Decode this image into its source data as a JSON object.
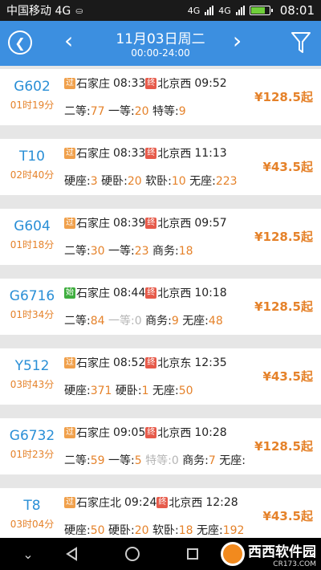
{
  "status": {
    "carrier": "中国移动 4G",
    "net1": "4G",
    "net2": "4G",
    "time": "08:01"
  },
  "header": {
    "date": "11月03日周二",
    "range": "00:00-24:00"
  },
  "trains": [
    {
      "number": "G602",
      "duration": "01时19分",
      "start_badge": "过",
      "from": "石家庄",
      "dep": "08:33",
      "end_badge": "终",
      "to": "北京西",
      "arr": "09:52",
      "price": "¥128.5起",
      "seats": [
        {
          "name": "二等",
          "count": "77"
        },
        {
          "name": "一等",
          "count": "20"
        },
        {
          "name": "特等",
          "count": "9"
        }
      ]
    },
    {
      "number": "T10",
      "duration": "02时40分",
      "start_badge": "过",
      "from": "石家庄",
      "dep": "08:33",
      "end_badge": "终",
      "to": "北京西",
      "arr": "11:13",
      "price": "¥43.5起",
      "seats": [
        {
          "name": "硬座",
          "count": "3"
        },
        {
          "name": "硬卧",
          "count": "20"
        },
        {
          "name": "软卧",
          "count": "10"
        },
        {
          "name": "无座",
          "count": "223"
        }
      ]
    },
    {
      "number": "G604",
      "duration": "01时18分",
      "start_badge": "过",
      "from": "石家庄",
      "dep": "08:39",
      "end_badge": "终",
      "to": "北京西",
      "arr": "09:57",
      "price": "¥128.5起",
      "seats": [
        {
          "name": "二等",
          "count": "30"
        },
        {
          "name": "一等",
          "count": "23"
        },
        {
          "name": "商务",
          "count": "18"
        }
      ]
    },
    {
      "number": "G6716",
      "duration": "01时34分",
      "start_badge": "始",
      "from": "石家庄",
      "dep": "08:44",
      "end_badge": "终",
      "to": "北京西",
      "arr": "10:18",
      "price": "¥128.5起",
      "seats": [
        {
          "name": "二等",
          "count": "84"
        },
        {
          "name": "一等",
          "count": "0"
        },
        {
          "name": "商务",
          "count": "9"
        },
        {
          "name": "无座",
          "count": "48"
        }
      ]
    },
    {
      "number": "Y512",
      "duration": "03时43分",
      "start_badge": "过",
      "from": "石家庄",
      "dep": "08:52",
      "end_badge": "终",
      "to": "北京东",
      "arr": "12:35",
      "price": "¥43.5起",
      "seats": [
        {
          "name": "硬座",
          "count": "371"
        },
        {
          "name": "硬卧",
          "count": "1"
        },
        {
          "name": "无座",
          "count": "50"
        }
      ]
    },
    {
      "number": "G6732",
      "duration": "01时23分",
      "start_badge": "过",
      "from": "石家庄",
      "dep": "09:05",
      "end_badge": "终",
      "to": "北京西",
      "arr": "10:28",
      "price": "¥128.5起",
      "seats": [
        {
          "name": "二等",
          "count": "59"
        },
        {
          "name": "一等",
          "count": "5"
        },
        {
          "name": "特等",
          "count": "0"
        },
        {
          "name": "商务",
          "count": "7"
        },
        {
          "name": "无座",
          "count": ""
        }
      ]
    },
    {
      "number": "T8",
      "duration": "03时04分",
      "start_badge": "过",
      "from": "石家庄北",
      "dep": "09:24",
      "end_badge": "终",
      "to": "北京西",
      "arr": "12:28",
      "price": "¥43.5起",
      "seats": [
        {
          "name": "硬座",
          "count": "50"
        },
        {
          "name": "硬卧",
          "count": "20"
        },
        {
          "name": "软卧",
          "count": "18"
        },
        {
          "name": "无座",
          "count": "192"
        }
      ]
    }
  ],
  "watermark": {
    "brand": "西西软件园",
    "url": "CR173.COM"
  },
  "colors": {
    "header": "#3c8fe0",
    "accent": "#e5822a",
    "train_number": "#2a8fd6"
  }
}
